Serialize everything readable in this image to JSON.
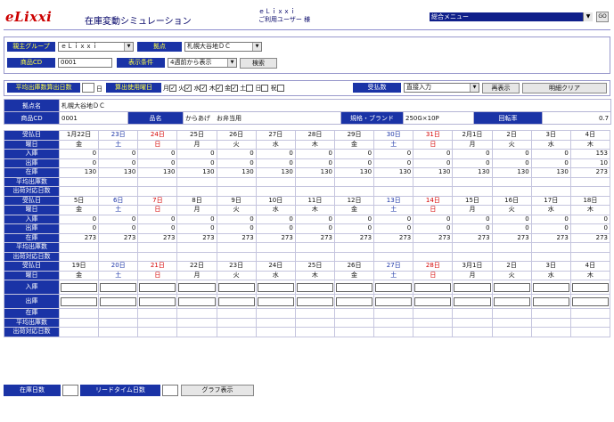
{
  "header": {
    "logo": "eLixxi",
    "title": "在庫変動シミュレーション",
    "user_company": "ｅＬｉｘｘｉ",
    "user_name": "ご利用ユーザー 様",
    "menu_select": "総合メニュー",
    "go_label": "GO"
  },
  "filters": {
    "group_label": "親主グループ",
    "group_value": "ｅＬｉｘｘｉ",
    "site_label": "拠点",
    "site_value": "札幌大谷地ＤＣ",
    "product_label": "商品CD",
    "product_value": "0001",
    "display_label": "表示条件",
    "display_value": "4週前から表示",
    "search_label": "検索"
  },
  "options": {
    "avg_days_label": "平均出庫数算出日数",
    "avg_days_unit": "日",
    "weekday_label": "算出使用曜日",
    "days": [
      {
        "name": "月",
        "mark": "✓"
      },
      {
        "name": "火",
        "mark": "✓"
      },
      {
        "name": "水",
        "mark": "✓"
      },
      {
        "name": "木",
        "mark": "✓"
      },
      {
        "name": "金",
        "mark": "✓"
      },
      {
        "name": "土",
        "mark": ""
      },
      {
        "name": "日",
        "mark": ""
      },
      {
        "name": "祝",
        "mark": ""
      }
    ],
    "supply_label": "受払数",
    "supply_value": "直接入力",
    "redisplay_label": "再表示",
    "clear_label": "明細クリア"
  },
  "info": {
    "site_label": "拠点名",
    "site_value": "札幌大谷地ＤＣ",
    "product_cd_label": "商品CD",
    "product_cd_value": "0001",
    "name_label": "品名",
    "name_value": "からあげ　お弁当用",
    "spec_label": "規格・ブランド",
    "spec_value": "250G×10P",
    "turnover_label": "回転率",
    "turnover_value": "0.7"
  },
  "grid": {
    "row_labels": {
      "date": "受払日",
      "weekday": "曜日",
      "in": "入庫",
      "out": "出庫",
      "stock": "在庫",
      "avg_out": "平均出庫数",
      "days_cover": "出荷対応日数"
    },
    "blocks": [
      {
        "dates": [
          "1月22日",
          "23日",
          "24日",
          "25日",
          "26日",
          "27日",
          "28日",
          "29日",
          "30日",
          "31日",
          "2月1日",
          "2日",
          "3日",
          "4日"
        ],
        "weekdays": [
          "金",
          "土",
          "日",
          "月",
          "火",
          "水",
          "木",
          "金",
          "土",
          "日",
          "月",
          "火",
          "水",
          "木"
        ],
        "in": [
          "0",
          "0",
          "0",
          "0",
          "0",
          "0",
          "0",
          "0",
          "0",
          "0",
          "0",
          "0",
          "0",
          "153"
        ],
        "out": [
          "0",
          "0",
          "0",
          "0",
          "0",
          "0",
          "0",
          "0",
          "0",
          "0",
          "0",
          "0",
          "0",
          "10"
        ],
        "stock": [
          "130",
          "130",
          "130",
          "130",
          "130",
          "130",
          "130",
          "130",
          "130",
          "130",
          "130",
          "130",
          "130",
          "273"
        ]
      },
      {
        "dates": [
          "5日",
          "6日",
          "7日",
          "8日",
          "9日",
          "10日",
          "11日",
          "12日",
          "13日",
          "14日",
          "15日",
          "16日",
          "17日",
          "18日"
        ],
        "weekdays": [
          "金",
          "土",
          "日",
          "月",
          "火",
          "水",
          "木",
          "金",
          "土",
          "日",
          "月",
          "火",
          "水",
          "木"
        ],
        "in": [
          "0",
          "0",
          "0",
          "0",
          "0",
          "0",
          "0",
          "0",
          "0",
          "0",
          "0",
          "0",
          "0",
          "0"
        ],
        "out": [
          "0",
          "0",
          "0",
          "0",
          "0",
          "0",
          "0",
          "0",
          "0",
          "0",
          "0",
          "0",
          "0",
          "0"
        ],
        "stock": [
          "273",
          "273",
          "273",
          "273",
          "273",
          "273",
          "273",
          "273",
          "273",
          "273",
          "273",
          "273",
          "273",
          "273"
        ]
      },
      {
        "dates": [
          "19日",
          "20日",
          "21日",
          "22日",
          "23日",
          "24日",
          "25日",
          "26日",
          "27日",
          "28日",
          "3月1日",
          "2日",
          "3日",
          "4日"
        ],
        "weekdays": [
          "金",
          "土",
          "日",
          "月",
          "火",
          "水",
          "木",
          "金",
          "土",
          "日",
          "月",
          "火",
          "水",
          "木"
        ]
      }
    ]
  },
  "footer": {
    "stock_days_label": "在庫日数",
    "lead_time_label": "リードタイム日数",
    "graph_label": "グラフ表示"
  }
}
